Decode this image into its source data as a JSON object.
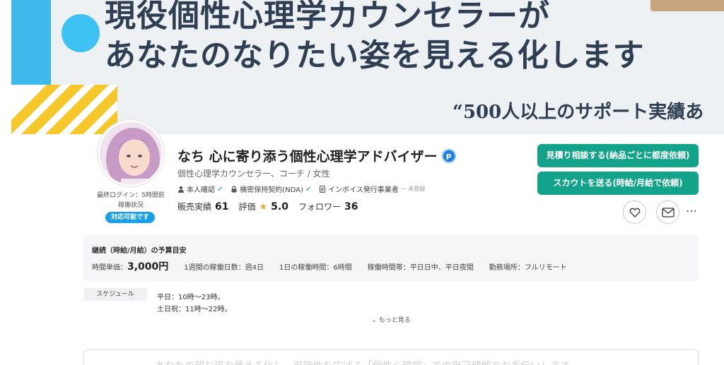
{
  "hero": {
    "headline_line1": "現役個性心理学カウンセラーが",
    "headline_line2": "あなたのなりたい姿を見える化します",
    "tagline": "“500人以上のサポート実績あ"
  },
  "profile": {
    "last_login": "最終ログイン：5時間前",
    "work_status": "稼働状況",
    "availability_badge": "対応可能です",
    "name": "なち 心に寄り添う個性心理学アドバイザー",
    "pro_badge": "P",
    "subtitle": "個性心理学カウンセラー、コーチ / 女性",
    "verifications": {
      "identity": "本人確認",
      "nda": "機密保持契約(NDA)",
      "invoice": "インボイス発行事業者",
      "invoice_status": "— 未登録"
    },
    "stats": {
      "sales_label": "販売実績",
      "sales_value": "61",
      "rating_label": "評価",
      "rating_value": "5.0",
      "followers_label": "フォロワー",
      "followers_value": "36"
    }
  },
  "actions": {
    "estimate_button": "見積り相談する(納品ごとに都度依頼)",
    "scout_button": "スカウトを送る(時給/月給で依頼)",
    "more": "⋯"
  },
  "budget": {
    "title": "継続（時給/月給）の予算目安",
    "rate_label": "時間単価：",
    "rate_value": "3,000円",
    "days_per_week": "1週間の稼働日数：週4日",
    "hours_per_day": "1日の稼働時間：6時間",
    "time_slots": "稼働時間帯：平日日中、平日夜間",
    "location": "勤務場所：フルリモート"
  },
  "schedule": {
    "label": "スケジュール",
    "weekday": "平日：10時〜23時。",
    "weekend": "土日祝：11時〜22時。",
    "see_more": "⌄ もっと見る"
  },
  "bottom": {
    "faint_text": "あなたの望む姿を見える化し、可能性を広げる「個性心理学」での自己理解をお手伝いします"
  },
  "colors": {
    "accent_green": "#12a38a",
    "badge_blue": "#1a9ee8",
    "star": "#f5a623",
    "hero_blue": "#3fb8ec",
    "hero_yellow": "#f5c72b"
  }
}
